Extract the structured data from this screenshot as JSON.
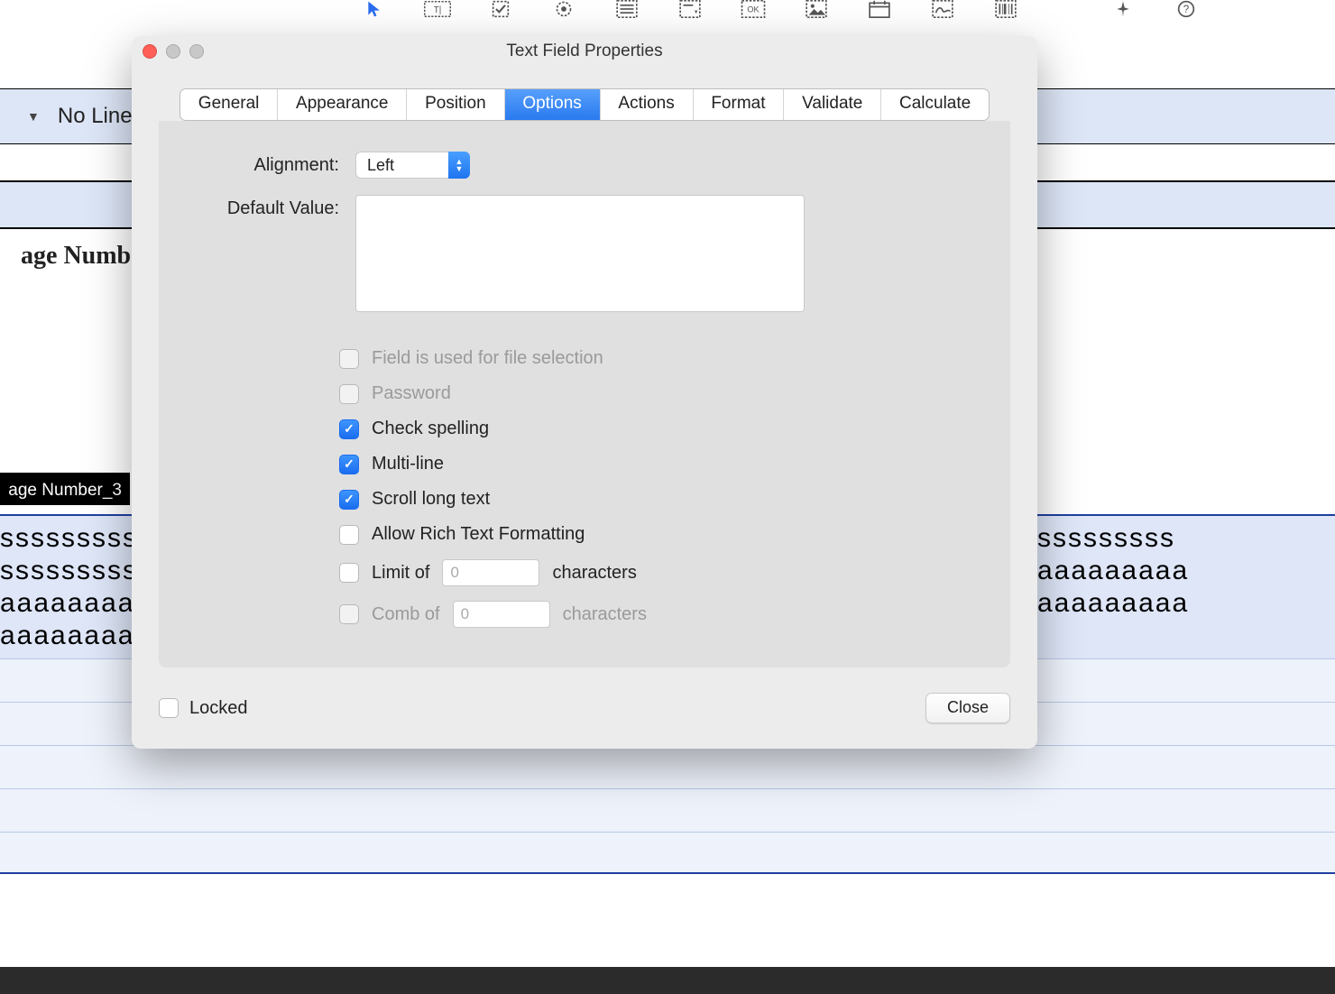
{
  "toolbar": {
    "no_line": "No Line"
  },
  "background": {
    "heading_left": "age Number",
    "field_tag": "age Number_3",
    "row_text_s": "ssssssssss",
    "row_text_a": "aaaaaaaaa",
    "row_text_s_right": "sssssssss",
    "row_text_a_right": "aaaaaaaaa"
  },
  "dialog": {
    "title": "Text Field Properties",
    "tabs": {
      "general": "General",
      "appearance": "Appearance",
      "position": "Position",
      "options": "Options",
      "actions": "Actions",
      "format": "Format",
      "validate": "Validate",
      "calculate": "Calculate"
    },
    "labels": {
      "alignment": "Alignment:",
      "default_value": "Default Value:"
    },
    "alignment_value": "Left",
    "default_value": "",
    "options": {
      "file_selection": "Field is used for file selection",
      "password": "Password",
      "check_spelling": "Check spelling",
      "multi_line": "Multi-line",
      "scroll_long_text": "Scroll long text",
      "allow_rich_text": "Allow Rich Text Formatting",
      "limit_of": "Limit of",
      "limit_chars": "characters",
      "limit_value": "0",
      "comb_of": "Comb of",
      "comb_chars": "characters",
      "comb_value": "0"
    },
    "footer": {
      "locked": "Locked",
      "close": "Close"
    }
  }
}
